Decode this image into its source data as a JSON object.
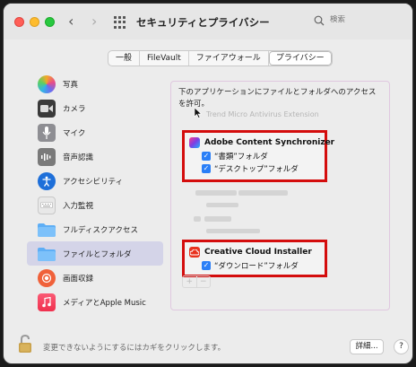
{
  "window": {
    "title": "セキュリティとプライバシー",
    "nav_back": "‹",
    "nav_forward": "›"
  },
  "search": {
    "placeholder": "検索"
  },
  "tabs": [
    {
      "label": "一般"
    },
    {
      "label": "FileVault"
    },
    {
      "label": "ファイアウォール"
    },
    {
      "label": "プライバシー",
      "active": true
    }
  ],
  "sidebar": {
    "items": [
      {
        "label": "写真",
        "icon": "photos-icon",
        "color": "#f4a825"
      },
      {
        "label": "カメラ",
        "icon": "camera-icon",
        "color": "#3a3a3a"
      },
      {
        "label": "マイク",
        "icon": "microphone-icon",
        "color": "#8e8e93"
      },
      {
        "label": "音声認識",
        "icon": "speech-recognition-icon",
        "color": "#7a7a7a"
      },
      {
        "label": "アクセシビリティ",
        "icon": "accessibility-icon",
        "color": "#1e6fd9"
      },
      {
        "label": "入力監視",
        "icon": "keyboard-icon",
        "color": "#e0e0e0"
      },
      {
        "label": "フルディスクアクセス",
        "icon": "folder-icon",
        "color": "#5eaef5"
      },
      {
        "label": "ファイルとフォルダ",
        "icon": "folder-icon",
        "color": "#5eaef5",
        "selected": true
      },
      {
        "label": "画面収録",
        "icon": "screen-recording-icon",
        "color": "#f0613a"
      },
      {
        "label": "メディアとApple Music",
        "icon": "music-icon",
        "color": "#f9405d"
      }
    ]
  },
  "content": {
    "description": "下のアプリケーションにファイルとフォルダへのアクセスを許可。",
    "faded_app": "Trend Micro Antivirus Extension",
    "apps": [
      {
        "name": "Adobe Content Synchronizer",
        "icon": "adobe-icon",
        "color": "#b030a0",
        "permissions": [
          {
            "label": "“書類”フォルダ",
            "checked": true
          },
          {
            "label": "“デスクトップ”フォルダ",
            "checked": true
          }
        ]
      },
      {
        "name": "Creative Cloud Installer",
        "icon": "creative-cloud-icon",
        "color": "#e8321e",
        "permissions": [
          {
            "label": "“ダウンロード”フォルダ",
            "checked": true
          }
        ]
      }
    ],
    "add_label": "+",
    "remove_label": "−"
  },
  "footer": {
    "lock_text": "変更できないようにするにはカギをクリックします。",
    "details_label": "詳細...",
    "help_label": "?"
  },
  "colors": {
    "highlight_border": "#d40d0d",
    "checkbox": "#2a7ff7",
    "selected_row": "#d4d4e8"
  }
}
